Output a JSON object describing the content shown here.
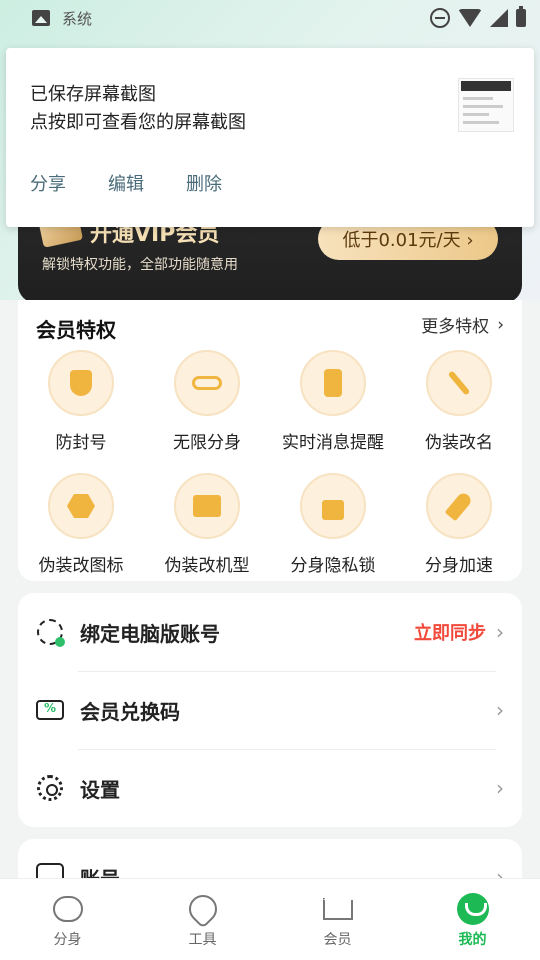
{
  "status_bar": {
    "app_label": "系统"
  },
  "notification": {
    "line1": "已保存屏幕截图",
    "line2": "点按即可查看您的屏幕截图",
    "actions": [
      "分享",
      "编辑",
      "删除"
    ]
  },
  "vip": {
    "title": "开通VIP会员",
    "subtitle": "解锁特权功能，全部功能随意用",
    "button": "低于0.01元/天 ›"
  },
  "privileges": {
    "title": "会员特权",
    "more": "更多特权",
    "items": [
      {
        "label": "防封号",
        "icon": "shield-icon"
      },
      {
        "label": "无限分身",
        "icon": "infinity-icon"
      },
      {
        "label": "实时消息提醒",
        "icon": "phone-icon"
      },
      {
        "label": "伪装改名",
        "icon": "magic-wand-icon"
      },
      {
        "label": "伪装改图标",
        "icon": "hexagon-icon"
      },
      {
        "label": "伪装改机型",
        "icon": "computer-icon"
      },
      {
        "label": "分身隐私锁",
        "icon": "lock-icon"
      },
      {
        "label": "分身加速",
        "icon": "rocket-icon"
      }
    ]
  },
  "menu": {
    "items": [
      {
        "label": "绑定电脑版账号",
        "action": "立即同步"
      },
      {
        "label": "会员兑换码",
        "action": ""
      },
      {
        "label": "设置",
        "action": ""
      }
    ]
  },
  "account": {
    "label": "账号"
  },
  "bottom_nav": {
    "tabs": [
      {
        "label": "分身",
        "icon": "chat-icon"
      },
      {
        "label": "工具",
        "icon": "wrench-icon"
      },
      {
        "label": "会员",
        "icon": "crown-icon"
      },
      {
        "label": "我的",
        "icon": "smiley-icon"
      }
    ],
    "active": "我的"
  },
  "colors": {
    "accent": "#1db954",
    "action_red": "#f24a3a",
    "gold": "#f0b53f"
  }
}
